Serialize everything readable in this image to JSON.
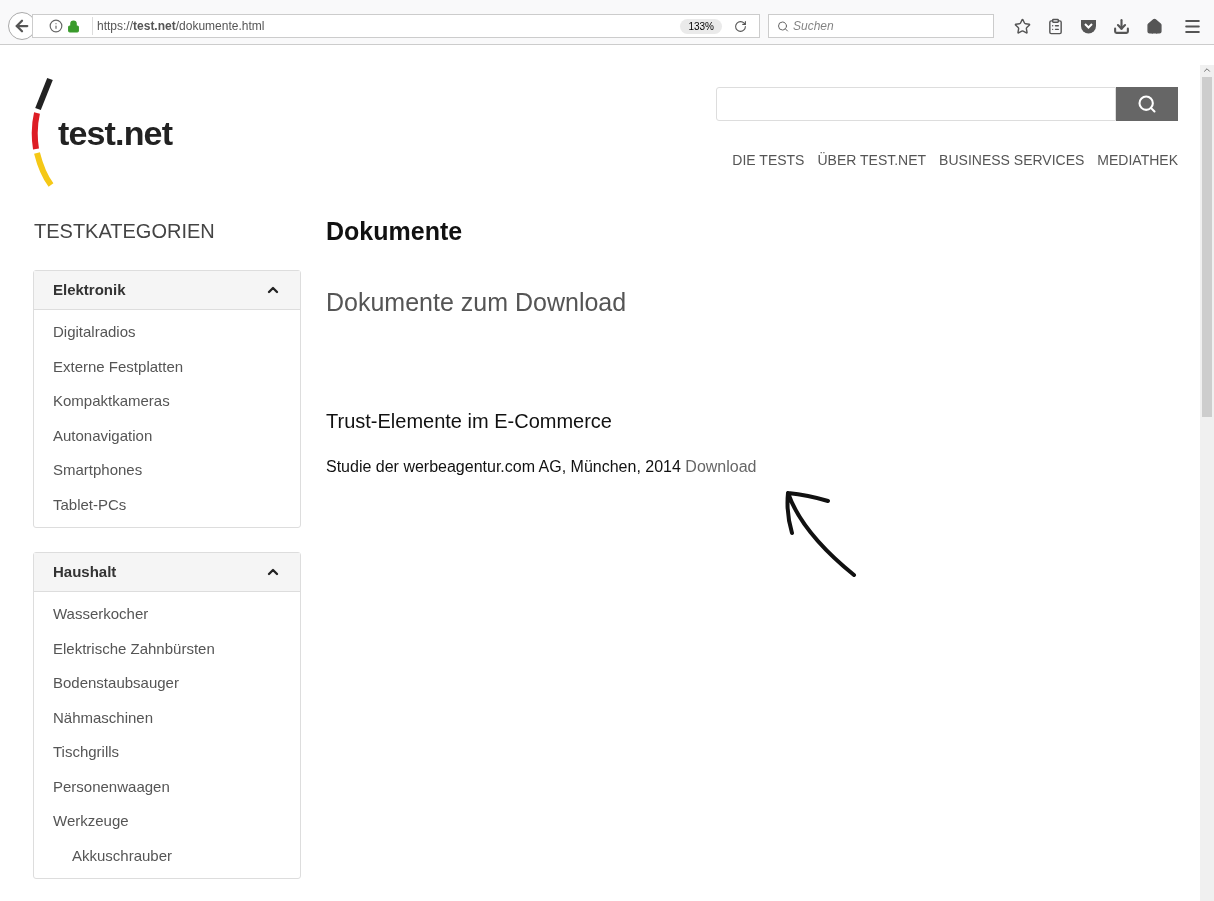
{
  "browser": {
    "url": "https://**test.net**/dokumente.html",
    "zoom": "133%",
    "search": {
      "placeholder": "Suchen"
    }
  },
  "header": {
    "logo": "test.net",
    "nav": [
      "DIE TESTS",
      "ÜBER TEST.NET",
      "BUSINESS SERVICES",
      "MEDIATHEK"
    ]
  },
  "sidebar": {
    "title": "TESTKATEGORIEN",
    "panels": [
      {
        "title": "Elektronik",
        "expanded": true,
        "items": [
          {
            "label": "Digitalradios"
          },
          {
            "label": "Externe Festplatten"
          },
          {
            "label": "Kompaktkameras"
          },
          {
            "label": "Autonavigation"
          },
          {
            "label": "Smartphones"
          },
          {
            "label": "Tablet-PCs"
          }
        ]
      },
      {
        "title": "Haushalt",
        "expanded": true,
        "items": [
          {
            "label": "Wasserkocher"
          },
          {
            "label": "Elektrische Zahnbürsten"
          },
          {
            "label": "Bodenstaubsauger"
          },
          {
            "label": "Nähmaschinen"
          },
          {
            "label": "Tischgrills"
          },
          {
            "label": "Personenwaagen"
          },
          {
            "label": "Werkzeuge",
            "children": [
              {
                "label": "Akkuschrauber"
              }
            ]
          }
        ]
      }
    ]
  },
  "main": {
    "title": "Dokumente",
    "subtitle": "Dokumente zum Download",
    "documents": [
      {
        "title": "Trust-Elemente im E-Commerce",
        "description": "Studie der werbeagentur.com AG, München, 2014",
        "link": "Download"
      }
    ]
  }
}
